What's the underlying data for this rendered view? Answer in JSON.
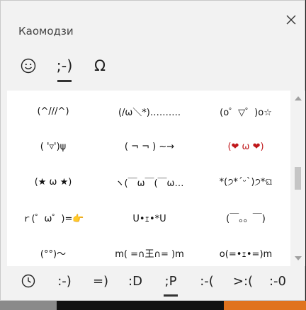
{
  "panel": {
    "title": "Каомодзи"
  },
  "categories": [
    {
      "label": "☺",
      "icon": "smiley-face-icon"
    },
    {
      "label": ";-)",
      "active": true
    },
    {
      "label": "Ω",
      "icon": "omega-symbol-icon"
    }
  ],
  "kaomoji": [
    [
      "(^///^)",
      "(/ω＼*)……….",
      "(o゜▽゜)o☆"
    ],
    [
      "( '▿')ψ",
      "( ¬ ¬ ) ~→",
      "(❤ ω ❤)"
    ],
    [
      "(★ ω ★)",
      "ヽ(￣ω￣(￣ω…",
      "*(੭*ˊᵕˋ)੭*ଘ"
    ],
    [
      "ｒ(゜ω゜)=👉",
      "U•ｪ•*U",
      "(￣。。￣)"
    ],
    [
      "(°°)～",
      "m( =∩王∩= )m",
      "o(=•ｪ•=)m"
    ]
  ],
  "bottom_tabs": [
    {
      "label": "",
      "icon": "recent-clock-icon"
    },
    {
      "label": ":-)"
    },
    {
      "label": "=)"
    },
    {
      "label": ":D"
    },
    {
      "label": ";P",
      "active": true
    },
    {
      "label": ":-("
    },
    {
      "label": ">:("
    },
    {
      "label": ":-0"
    }
  ],
  "colors": {
    "panel_bg": "#f2f2f2",
    "content_bg": "#ffffff",
    "accent_underline": "#333333",
    "background_strip_dark": "#1e1e1e",
    "background_strip_orange": "#e0731e",
    "background_strip_gray": "#8a8a8a"
  }
}
